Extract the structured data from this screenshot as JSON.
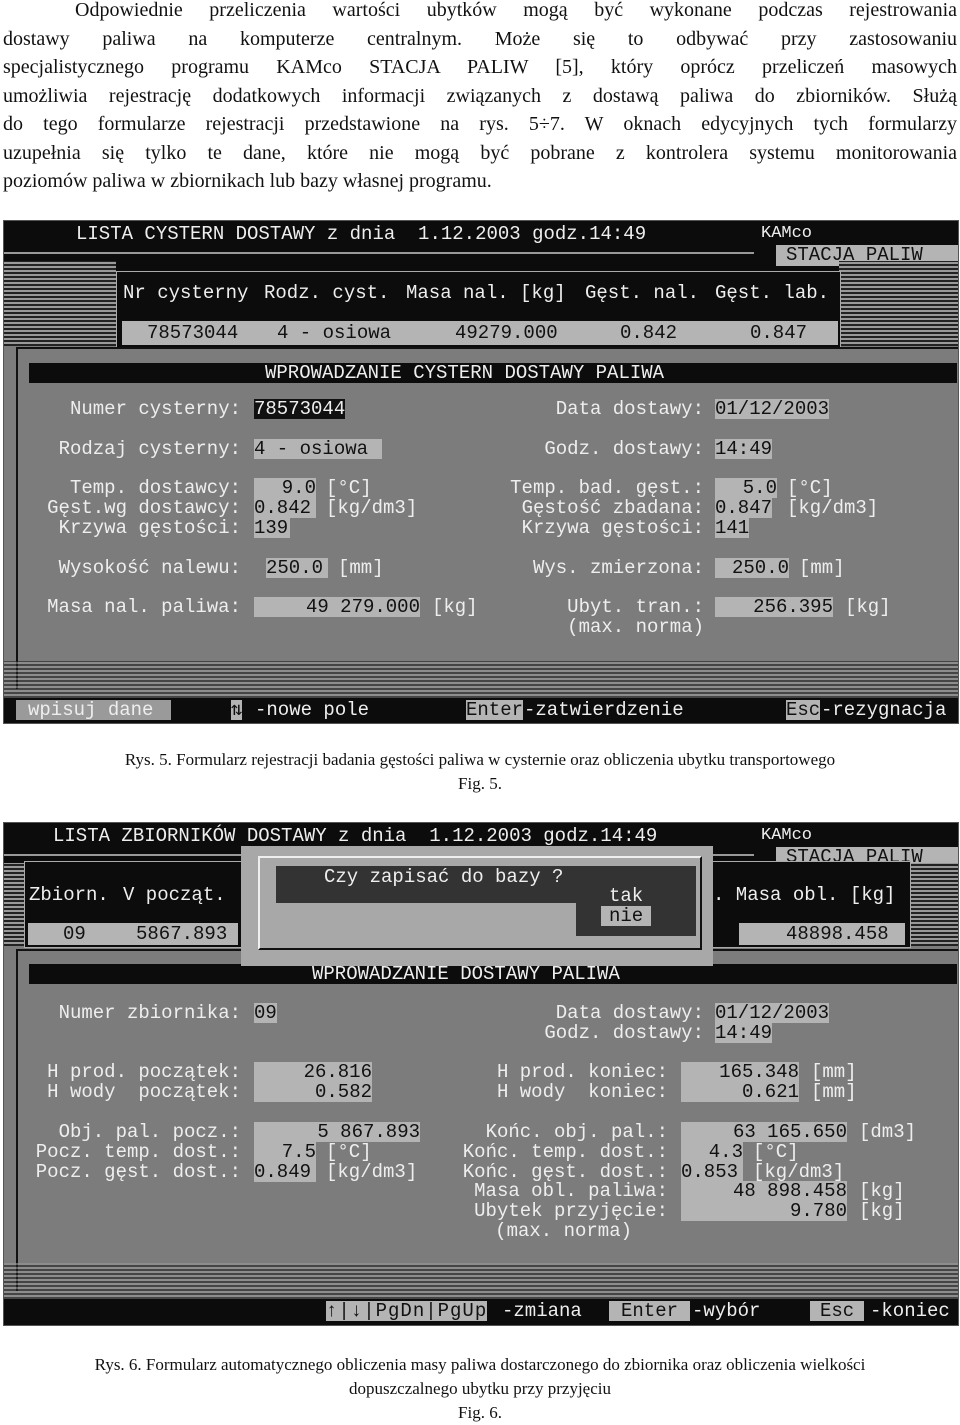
{
  "paragraph": [
    "Odpowiednie przeliczenia wartości ubytków mogą być wykonane podczas rejestrowania",
    "dostawy paliwa na komputerze centralnym. Może się to odbywać przy zastosowaniu",
    "specjalistycznego programu KAMco STACJA PALIW [5], który oprócz przeliczeń masowych",
    "umożliwia rejestrację dodatkowych informacji związanych z dostawą paliwa do zbiorników. Służą",
    "do tego formularze rejestracji przedstawione na rys. 5÷7. W oknach edycyjnych tych formularzy",
    "uzupełnia się tylko te dane, które nie mogą być pobrane z kontrolera systemu monitorowania",
    "poziomów paliwa w zbiornikach lub bazy własnej programu."
  ],
  "brand": {
    "top": "KAMco",
    "box": "STACJA PALIW"
  },
  "fig5": {
    "title": "LISTA CYSTERN DOSTAWY z dnia  1.12.2003 godz.14:49",
    "columns": [
      "Nr cysterny",
      "Rodz. cyst.",
      "Masa nal. [kg]",
      "Gęst. nal.",
      "Gęst. lab."
    ],
    "row": [
      "78573044",
      "4 - osiowa",
      "49279.000",
      "0.842",
      "0.847"
    ],
    "form_title": "WPROWADZANIE CYSTERN DOSTAWY PALIWA",
    "left": {
      "numer_label": "Numer cysterny:",
      "numer_value": "78573044",
      "rodzaj_label": "Rodzaj cysterny:",
      "rodzaj_value": "4 - osiowa",
      "temp_label": "Temp. dostawcy:",
      "temp_value": "9.0",
      "temp_unit": "[°C]",
      "gest_label": "Gęst.wg dostawcy:",
      "gest_value": "0.842",
      "gest_unit": "[kg/dm3]",
      "krzywa_label": "Krzywa gęstości:",
      "krzywa_value": "139",
      "wys_label": "Wysokość nalewu:",
      "wys_value": "250.0",
      "wys_unit": "[mm]",
      "masa_label": "Masa nal. paliwa:",
      "masa_value": "49 279.000",
      "masa_unit": "[kg]"
    },
    "right": {
      "data_label": "Data dostawy:",
      "data_value": "01/12/2003",
      "godz_label": "Godz. dostawy:",
      "godz_value": "14:49",
      "temp_label": "Temp. bad. gęst.:",
      "temp_value": "5.0",
      "temp_unit": "[°C]",
      "gest_label": "Gęstość zbadana:",
      "gest_value": "0.847",
      "gest_unit": "[kg/dm3]",
      "krzywa_label": "Krzywa gęstości:",
      "krzywa_value": "141",
      "wys_label": "Wys. zmierzona:",
      "wys_value": "250.0",
      "wys_unit": "[mm]",
      "ubyt_label": "Ubyt. tran.:",
      "ubyt_value": "256.395",
      "ubyt_unit": "[kg]",
      "norma_label": "(max. norma)"
    },
    "status": {
      "mode": "wpisuj dane",
      "arrows": "⇅",
      "arrows_text": "-nowe pole",
      "enter": "Enter",
      "enter_text": "-zatwierdzenie",
      "esc": "Esc",
      "esc_text": "-rezygnacja"
    },
    "caption": "Rys. 5. Formularz rejestracji badania gęstości paliwa w cysternie oraz obliczenia ubytku transportowego",
    "fig": "Fig. 5."
  },
  "fig6": {
    "title": "LISTA ZBIORNIKÓW DOSTAWY z dnia  1.12.2003 godz.14:49",
    "columns": [
      "Zbiorn.",
      "V począt.",
      ". Masa obl. [kg]"
    ],
    "row": [
      "09",
      "5867.893",
      "48898.458"
    ],
    "dialog": {
      "question": "Czy zapisać do bazy ?",
      "yes": "tak",
      "no": "nie"
    },
    "form_title": "WPROWADZANIE DOSTAWY PALIWA",
    "left": {
      "numer_label": "Numer zbiornika:",
      "numer_value": "09",
      "hprod_label": "H prod. początek:",
      "hprod_value": "26.816",
      "hwody_label": "H wody  początek:",
      "hwody_value": "0.582",
      "obj_label": "Obj. pal. pocz.:",
      "obj_value": "5 867.893",
      "temp_label": "Pocz. temp. dost.:",
      "temp_value": "7.5",
      "temp_unit": "[°C]",
      "gest_label": "Pocz. gęst. dost.:",
      "gest_value": "0.849",
      "gest_unit": "[kg/dm3]"
    },
    "right": {
      "data_label": "Data dostawy:",
      "data_value": "01/12/2003",
      "godz_label": "Godz. dostawy:",
      "godz_value": "14:49",
      "hprod_label": "H prod. koniec:",
      "hprod_value": "165.348",
      "hprod_unit": "[mm]",
      "hwody_label": "H wody  koniec:",
      "hwody_value": "0.621",
      "hwody_unit": "[mm]",
      "obj_label": "Końc. obj. pal.:",
      "obj_value": "63 165.650",
      "obj_unit": "[dm3]",
      "temp_label": "Końc. temp. dost.:",
      "temp_value": "4.3",
      "temp_unit": "[°C]",
      "gest_label": "Końc. gęst. dost.:",
      "gest_value": "0.853",
      "gest_unit": "[kg/dm3]",
      "masa_label": "Masa obl. paliwa:",
      "masa_value": "48 898.458",
      "masa_unit": "[kg]",
      "ubytek_label": "Ubytek przyjęcie:",
      "ubytek_value": "9.780",
      "ubytek_unit": "[kg]",
      "norma_label": "(max. norma)"
    },
    "status": {
      "keys": "↑|↓|PgDn|PgUp",
      "keys_text": "-zmiana",
      "enter": "Enter",
      "enter_text": "-wybór",
      "esc": "Esc",
      "esc_text": "-koniec"
    },
    "caption_line1": "Rys. 6. Formularz automatycznego obliczenia masy paliwa dostarczonego do zbiornika oraz obliczenia wielkości",
    "caption_line2": "dopuszczalnego ubytku przy przyjęciu",
    "fig": "Fig. 6."
  }
}
